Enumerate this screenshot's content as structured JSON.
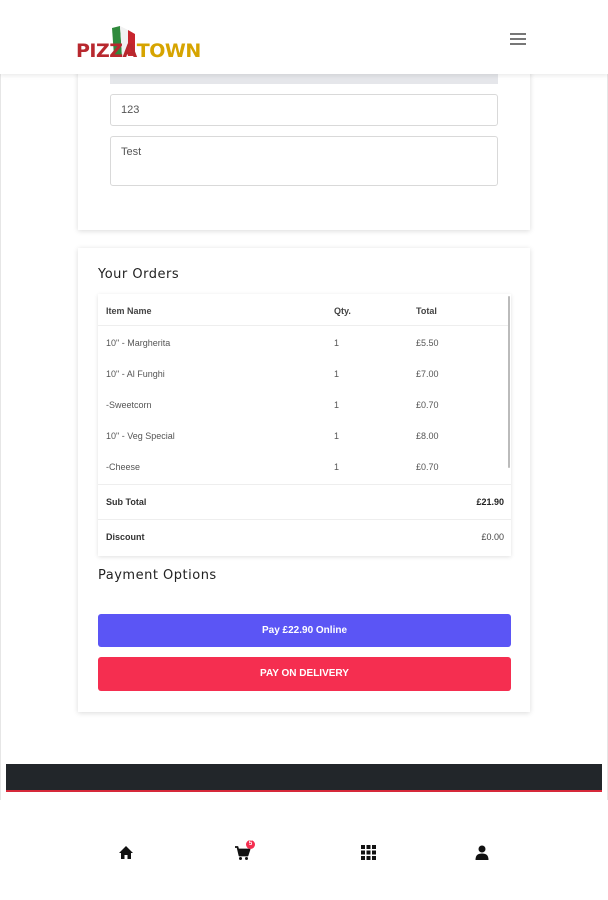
{
  "brand": {
    "logo_part1": "PIZZA",
    "logo_part2": "TOWN"
  },
  "header": {
    "menu_icon": "hamburger-icon"
  },
  "form": {
    "postcode_value": "123",
    "notes_value": "Test"
  },
  "orders": {
    "title": "Your Orders",
    "columns": {
      "name": "Item Name",
      "qty": "Qty.",
      "total": "Total"
    },
    "items": [
      {
        "name": "10\" - Margherita",
        "qty": "1",
        "total": "£5.50"
      },
      {
        "name": "10\" - Al Funghi",
        "qty": "1",
        "total": "£7.00"
      },
      {
        "name": "-Sweetcorn",
        "qty": "1",
        "total": "£0.70"
      },
      {
        "name": "10\" - Veg Special",
        "qty": "1",
        "total": "£8.00"
      },
      {
        "name": "-Cheese",
        "qty": "1",
        "total": "£0.70"
      }
    ],
    "subtotal_label": "Sub Total",
    "subtotal_value": "£21.90",
    "discount_label": "Discount",
    "discount_value": "£0.00"
  },
  "payment": {
    "title": "Payment Options",
    "online_label": "Pay £22.90 Online",
    "delivery_label": "PAY ON DELIVERY",
    "online_color": "#5b55f5",
    "delivery_color": "#f52e50"
  },
  "bottom_nav": {
    "cart_badge": "5",
    "icons": [
      "home-icon",
      "cart-icon",
      "grid-icon",
      "user-icon"
    ]
  }
}
